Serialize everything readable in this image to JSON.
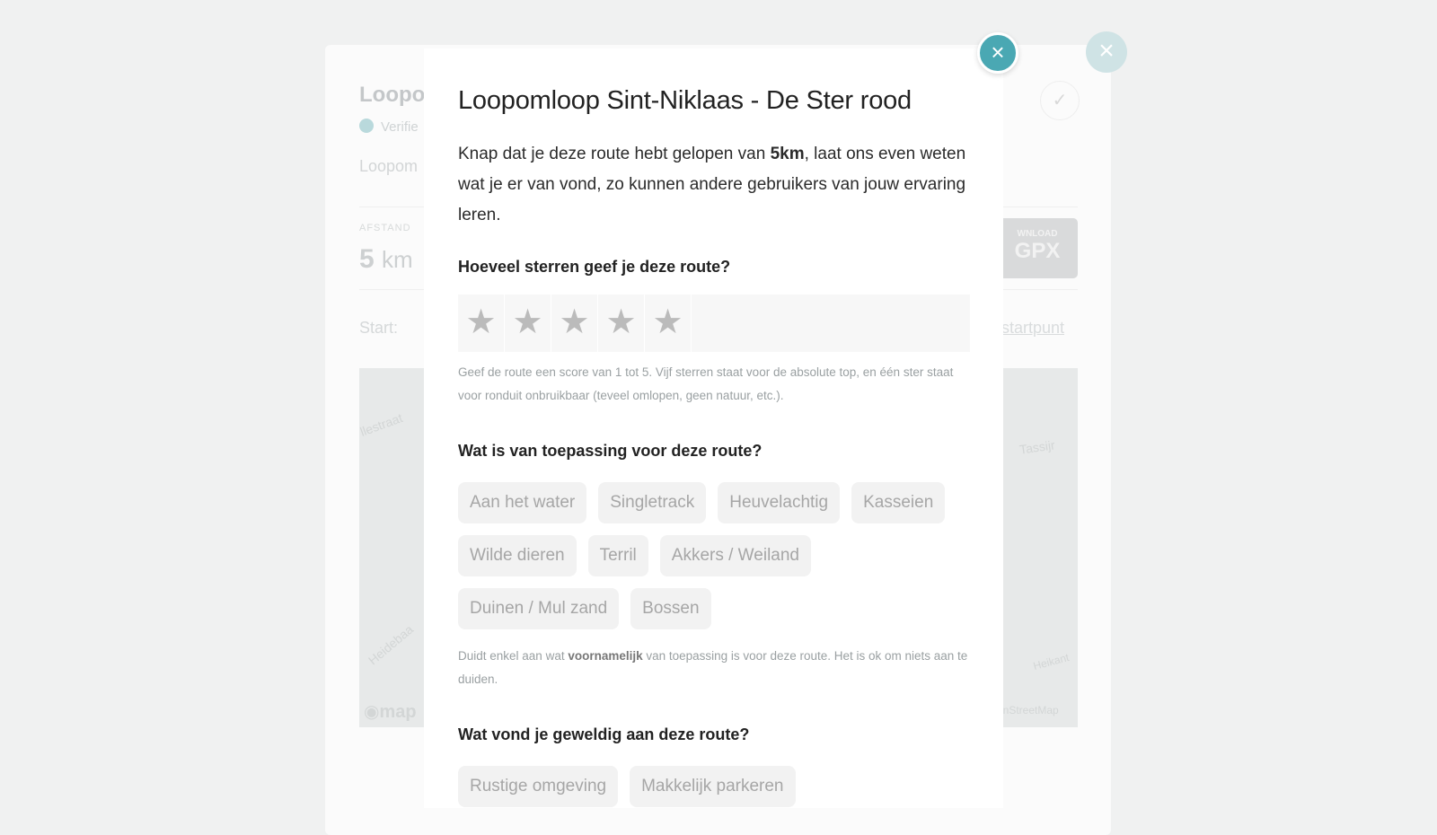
{
  "background": {
    "title": "Loopo",
    "verified": "Verifie",
    "subtitle": "Loopom",
    "distance_label": "AFSTAND",
    "distance_value": "5",
    "distance_unit": "km",
    "start_label": "Start:",
    "start_link": "startpunt",
    "download_small": "WNLOAD",
    "download_large": "GPX",
    "map_labels": [
      "llestraat",
      "Tassijr",
      "Heidebaa",
      "Heikant",
      "enStreetMap",
      "map"
    ]
  },
  "modal": {
    "title": "Loopomloop Sint-Niklaas - De Ster rood",
    "intro_before": "Knap dat je deze route hebt gelopen van ",
    "intro_distance": "5km",
    "intro_after": ", laat ons even weten wat je er van vond, zo kunnen andere gebruikers van jouw ervaring leren.",
    "rating": {
      "question": "Hoeveel sterren geef je deze route?",
      "stars": [
        "★",
        "★",
        "★",
        "★",
        "★"
      ],
      "selected": 0,
      "hint": "Geef de route een score van 1 tot 5. Vijf sterren staat voor de absolute top, en één ster staat voor ronduit onbruikbaar (teveel omlopen, geen natuur, etc.)."
    },
    "applicable": {
      "question": "Wat is van toepassing voor deze route?",
      "options": [
        "Aan het water",
        "Singletrack",
        "Heuvelachtig",
        "Kasseien",
        "Wilde dieren",
        "Terril",
        "Akkers / Weiland",
        "Duinen / Mul zand",
        "Bossen"
      ],
      "hint_before": "Duidt enkel aan wat ",
      "hint_bold": "voornamelijk",
      "hint_after": " van toepassing is voor deze route. Het is ok om niets aan te duiden."
    },
    "great": {
      "question": "Wat vond je geweldig aan deze route?",
      "options": [
        "Rustige omgeving",
        "Makkelijk parkeren"
      ]
    }
  },
  "colors": {
    "accent": "#4aa8b3",
    "chip_bg": "#f2f2f2",
    "chip_text": "#a6a6a6",
    "star_empty": "#bbbbbb"
  }
}
